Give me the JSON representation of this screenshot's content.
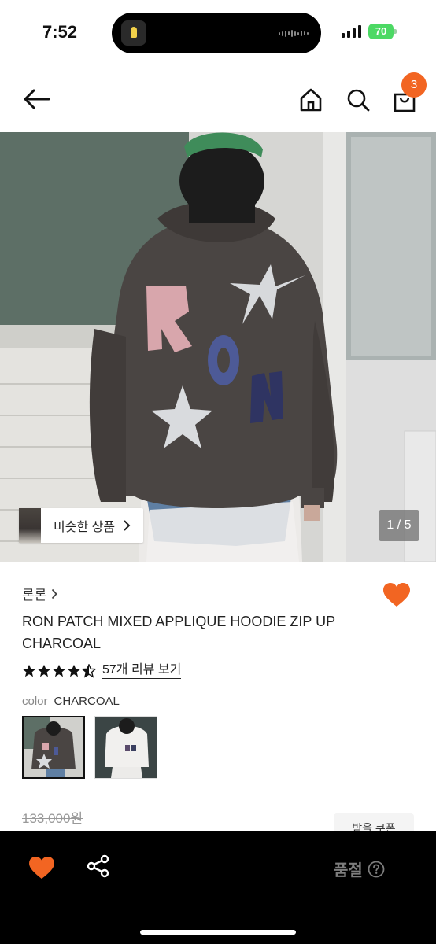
{
  "status_bar": {
    "time": "7:52",
    "battery": "70"
  },
  "header": {
    "cart_count": "3",
    "icons": [
      "back-arrow-icon",
      "home-icon",
      "search-icon",
      "shopping-bag-icon"
    ]
  },
  "gallery": {
    "similar_label": "비슷한 상품",
    "page_indicator": "1 / 5"
  },
  "product": {
    "brand": "론론",
    "title": "RON PATCH MIXED APPLIQUE HOODIE ZIP UP CHARCOAL",
    "rating": 4.5,
    "review_link": "57개 리뷰 보기",
    "color_label": "color",
    "color_value": "CHARCOAL",
    "original_price": "133,000원",
    "coupon_label": "받을 쿠폰"
  },
  "bottom_bar": {
    "soldout_label": "품절"
  },
  "colors": {
    "accent": "#f26522",
    "heart": "#f26522",
    "bottom_bar": "#000000"
  }
}
